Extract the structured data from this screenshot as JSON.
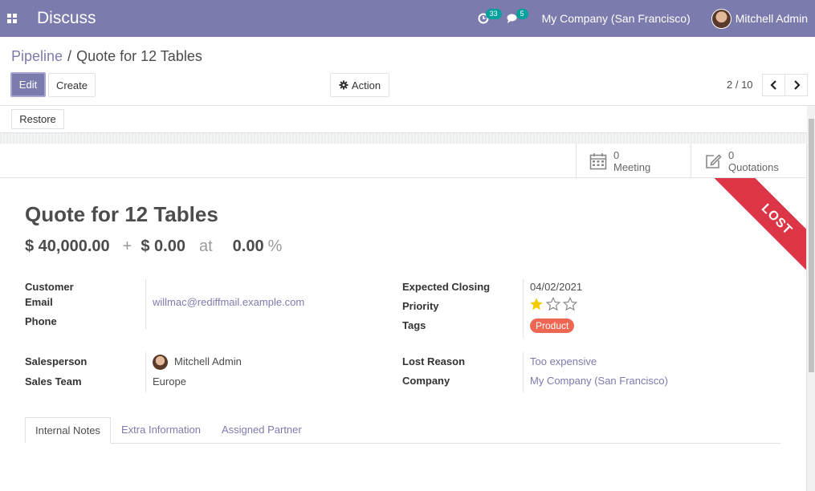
{
  "navbar": {
    "app_title": "Discuss",
    "activity_count": "33",
    "messages_count": "5",
    "company": "My Company (San Francisco)",
    "user": "Mitchell Admin",
    "color": "#7c7bad"
  },
  "breadcrumb": {
    "parent": "Pipeline",
    "separator": "/",
    "current": "Quote for 12 Tables"
  },
  "toolbar": {
    "edit_label": "Edit",
    "create_label": "Create",
    "action_label": "Action",
    "action_icon": "gear-icon"
  },
  "pager": {
    "value": "2 / 10",
    "prev_icon": "chevron-left-icon",
    "next_icon": "chevron-right-icon"
  },
  "statusbar": {
    "restore_label": "Restore"
  },
  "smart_buttons": [
    {
      "count": "0",
      "label": "Meeting",
      "icon": "calendar-icon"
    },
    {
      "count": "0",
      "label": "Quotations",
      "icon": "edit-icon"
    }
  ],
  "ribbon": {
    "text": "LOST",
    "color": "#dc3545"
  },
  "record": {
    "title": "Quote for 12 Tables",
    "expected_revenue": "$ 40,000.00",
    "plus": "+",
    "prorated": "$ 0.00",
    "at": "at",
    "probability": "0.00",
    "percent": "%"
  },
  "fields_left": {
    "customer_label": "Customer",
    "email_label": "Email",
    "email_value": "willmac@rediffmail.example.com",
    "phone_label": "Phone",
    "salesperson_label": "Salesperson",
    "salesperson_value": "Mitchell Admin",
    "sales_team_label": "Sales Team",
    "sales_team_value": "Europe"
  },
  "fields_right": {
    "expected_closing_label": "Expected Closing",
    "expected_closing_value": "04/02/2021",
    "priority_label": "Priority",
    "priority_stars": 1,
    "priority_max": 3,
    "tags_label": "Tags",
    "tag_value": "Product",
    "tag_color": "#ee6753",
    "lost_reason_label": "Lost Reason",
    "lost_reason_value": "Too expensive",
    "company_label": "Company",
    "company_value": "My Company (San Francisco)"
  },
  "tabs": [
    {
      "label": "Internal Notes",
      "active": true
    },
    {
      "label": "Extra Information",
      "active": false
    },
    {
      "label": "Assigned Partner",
      "active": false
    }
  ]
}
